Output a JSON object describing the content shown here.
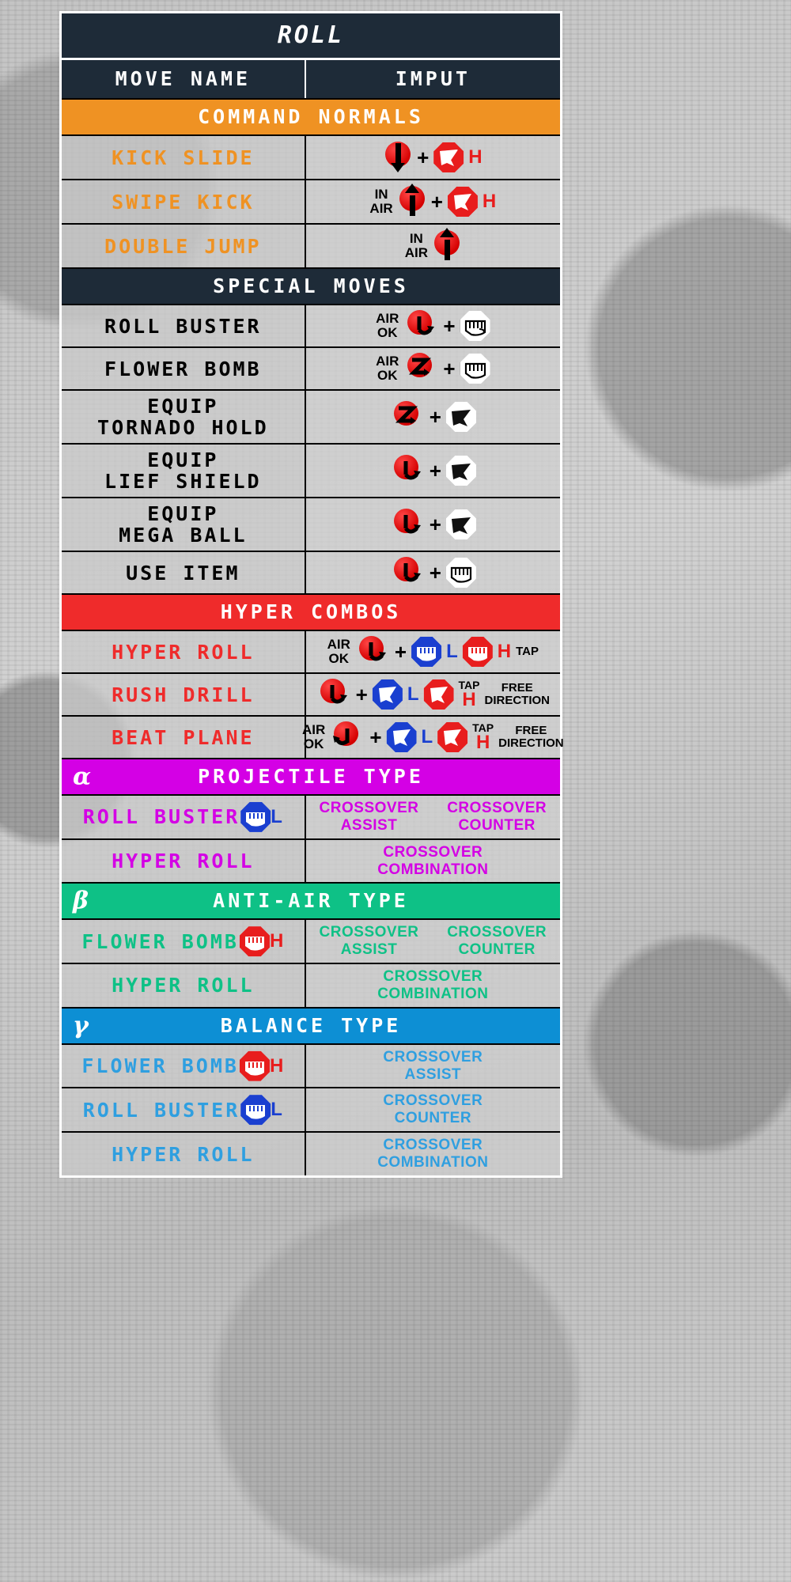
{
  "header": {
    "character": "ROLL",
    "col_move": "MOVE NAME",
    "col_input": "IMPUT"
  },
  "sections": [
    {
      "id": "command-normals",
      "label": "COMMAND NORMALS",
      "color": "#ef9223",
      "greek": ""
    },
    {
      "id": "special-moves",
      "label": "SPECIAL MOVES",
      "color": "#1e2b38",
      "greek": ""
    },
    {
      "id": "hyper-combos",
      "label": "HYPER COMBOS",
      "color": "#ef2b2b",
      "greek": ""
    },
    {
      "id": "projectile-type",
      "label": "PROJECTILE TYPE",
      "color": "#d400e5",
      "greek": "α"
    },
    {
      "id": "anti-air-type",
      "label": "ANTI-AIR TYPE",
      "color": "#0ec186",
      "greek": "β"
    },
    {
      "id": "balance-type",
      "label": "BALANCE TYPE",
      "color": "#0d8fd4",
      "greek": "γ"
    }
  ],
  "command_normals": [
    {
      "name": "KICK SLIDE",
      "pre": "",
      "strength": "H",
      "post": ""
    },
    {
      "name": "SWIPE KICK",
      "pre": "IN\nAIR",
      "strength": "H",
      "post": ""
    },
    {
      "name": "DOUBLE JUMP",
      "pre": "IN\nAIR",
      "strength": "",
      "post": ""
    }
  ],
  "special_moves": [
    {
      "name": "ROLL BUSTER",
      "pre": "AIR\nOK"
    },
    {
      "name": "FLOWER BOMB",
      "pre": "AIR\nOK"
    },
    {
      "name": "EQUIP\nTORNADO HOLD",
      "pre": ""
    },
    {
      "name": "EQUIP\nLIEF SHIELD",
      "pre": ""
    },
    {
      "name": "EQUIP\nMEGA BALL",
      "pre": ""
    },
    {
      "name": "USE ITEM",
      "pre": ""
    }
  ],
  "hyper_combos": [
    {
      "name": "HYPER ROLL",
      "pre": "AIR\nOK",
      "btn1": "L",
      "btn2": "H",
      "post": "TAP"
    },
    {
      "name": "RUSH DRILL",
      "pre": "",
      "btn1": "L",
      "btn2": "H",
      "post": "TAP",
      "post2": "FREE\nDIRECTION"
    },
    {
      "name": "BEAT PLANE",
      "pre": "AIR\nOK",
      "btn1": "L",
      "btn2": "H",
      "post": "TAP",
      "post2": "FREE\nDIRECTION"
    }
  ],
  "projectile_type": {
    "color": "#d400e5",
    "rows": [
      {
        "name": "ROLL BUSTER",
        "button": "L",
        "button_color": "blue",
        "roles": [
          "CROSSOVER\nASSIST",
          "CROSSOVER\nCOUNTER"
        ]
      },
      {
        "name": "HYPER ROLL",
        "button": "",
        "button_color": "",
        "roles": [
          "CROSSOVER\nCOMBINATION"
        ]
      }
    ]
  },
  "anti_air_type": {
    "color": "#0ec186",
    "rows": [
      {
        "name": "FLOWER BOMB",
        "button": "H",
        "button_color": "red",
        "roles": [
          "CROSSOVER\nASSIST",
          "CROSSOVER\nCOUNTER"
        ]
      },
      {
        "name": "HYPER ROLL",
        "button": "",
        "button_color": "",
        "roles": [
          "CROSSOVER\nCOMBINATION"
        ]
      }
    ]
  },
  "balance_type": {
    "color": "#2f9fe0",
    "rows": [
      {
        "name": "FLOWER BOMB",
        "button": "H",
        "button_color": "red",
        "roles": [
          "CROSSOVER\nASSIST"
        ]
      },
      {
        "name": "ROLL BUSTER",
        "button": "L",
        "button_color": "blue",
        "roles": [
          "CROSSOVER\nCOUNTER"
        ]
      },
      {
        "name": "HYPER ROLL",
        "button": "",
        "button_color": "",
        "roles": [
          "CROSSOVER\nCOMBINATION"
        ]
      }
    ]
  },
  "icons": {
    "down": "direction-down-icon",
    "up": "direction-up-icon",
    "qcf": "quarter-circle-forward-icon",
    "qcb": "quarter-circle-back-icon",
    "dpf": "dragon-punch-icon",
    "punch": "punch-button-icon",
    "kick": "kick-button-icon",
    "plus": "+"
  }
}
